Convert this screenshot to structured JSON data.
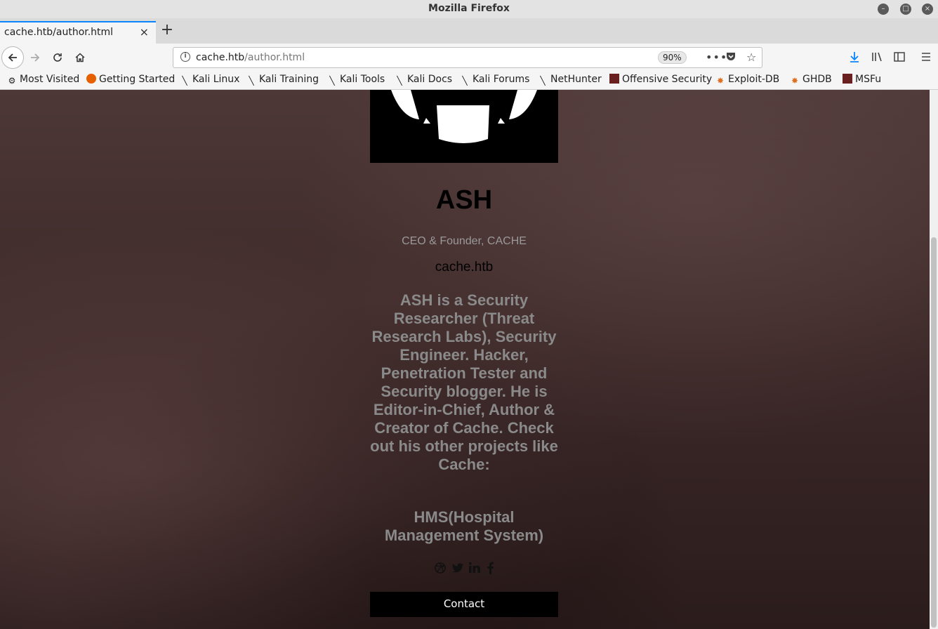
{
  "window": {
    "title": "Mozilla Firefox"
  },
  "tab": {
    "title": "cache.htb/author.html",
    "close": "×",
    "new_tab": "+"
  },
  "nav": {
    "url_host": "cache.htb",
    "url_path": "/author.html",
    "zoom": "90%"
  },
  "bookmarks": [
    {
      "label": "Most Visited",
      "icon": "gear-icon"
    },
    {
      "label": "Getting Started",
      "icon": "firefox-icon"
    },
    {
      "label": "Kali Linux",
      "icon": "kali-icon"
    },
    {
      "label": "Kali Training",
      "icon": "kali-icon"
    },
    {
      "label": "Kali Tools",
      "icon": "kali-icon"
    },
    {
      "label": "Kali Docs",
      "icon": "kali-icon"
    },
    {
      "label": "Kali Forums",
      "icon": "kali-icon"
    },
    {
      "label": "NetHunter",
      "icon": "kali-icon"
    },
    {
      "label": "Offensive Security",
      "icon": "offsec-icon"
    },
    {
      "label": "Exploit-DB",
      "icon": "exploitdb-icon"
    },
    {
      "label": "GHDB",
      "icon": "exploitdb-icon"
    },
    {
      "label": "MSFu",
      "icon": "offsec-icon"
    }
  ],
  "profile": {
    "name": "ASH",
    "role": "CEO & Founder, CACHE",
    "site": "cache.htb",
    "bio": "ASH is a Security Researcher (Threat Research Labs), Security Engineer. Hacker, Penetration Tester and Security blogger. He is Editor-in-Chief, Author & Creator of Cache. Check out his other projects like Cache:",
    "project": "HMS(Hospital Management System)",
    "contact_label": "Contact",
    "social_icons": [
      "dribbble-icon",
      "twitter-icon",
      "linkedin-icon",
      "facebook-icon"
    ]
  },
  "colors": {
    "accent": "#0a84ff",
    "page_bg": "#3c2828",
    "muted_text": "#8a8a8a"
  }
}
